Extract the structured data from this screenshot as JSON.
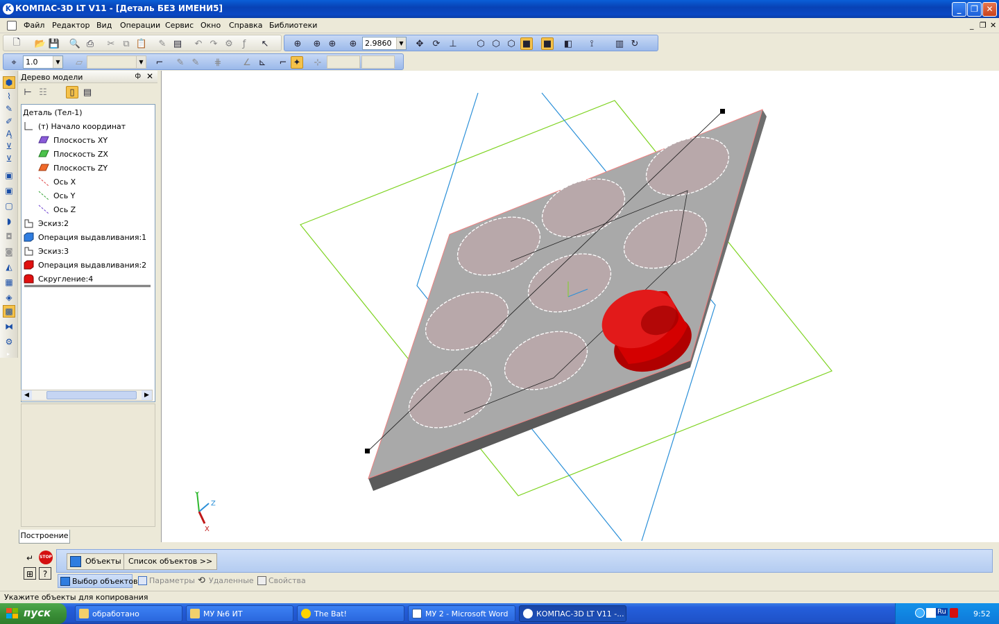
{
  "window": {
    "title": "КОМПАС-3D LT V11 - [Деталь БЕЗ ИМЕНИ5]",
    "icon_letter": "K",
    "minimize_label": "_",
    "maximize_label": "❐",
    "close_label": "✕"
  },
  "menu": {
    "items": [
      "Файл",
      "Редактор",
      "Вид",
      "Операции",
      "Сервис",
      "Окно",
      "Справка",
      "Библиотеки"
    ],
    "mdi_controls": [
      "_",
      "❐",
      "✕"
    ]
  },
  "toolbar": {
    "zoom_value": "2.9860",
    "step_value": "1.0"
  },
  "tree": {
    "panel_title": "Дерево модели",
    "pin_label": "ф",
    "close_label": "✕",
    "items": [
      {
        "label": "Деталь (Тел-1)",
        "icon": "none"
      },
      {
        "label": "(т) Начало координат",
        "icon": "origin-icon"
      },
      {
        "label": "Плоскость XY",
        "icon": "plane-xy-icon"
      },
      {
        "label": "Плоскость ZX",
        "icon": "plane-zx-icon"
      },
      {
        "label": "Плоскость ZY",
        "icon": "plane-zy-icon"
      },
      {
        "label": "Ось X",
        "icon": "axis-x-icon"
      },
      {
        "label": "Ось Y",
        "icon": "axis-y-icon"
      },
      {
        "label": "Ось Z",
        "icon": "axis-z-icon"
      },
      {
        "label": "Эскиз:2",
        "icon": "sketch-icon"
      },
      {
        "label": "Операция выдавливания:1",
        "icon": "extrude-icon"
      },
      {
        "label": "Эскиз:3",
        "icon": "sketch-icon"
      },
      {
        "label": "Операция выдавливания:2",
        "icon": "extrude-red-icon"
      },
      {
        "label": "Скругление:4",
        "icon": "fillet-icon"
      }
    ],
    "tab_label": "Построение"
  },
  "triad": {
    "x": "X",
    "y": "Y",
    "z": "Z"
  },
  "propbar": {
    "objects_label": "Объекты",
    "list_label": "Список объектов  >>",
    "tabs": [
      "Выбор объектов",
      "Параметры",
      "Удаленные",
      "Свойства"
    ],
    "stop_label": "STOP",
    "help_label": "?"
  },
  "status": {
    "message": "Укажите объекты для копирования"
  },
  "taskbar": {
    "start_label": "пуск",
    "tasks": [
      {
        "label": "обработано",
        "icon": "folder-icon"
      },
      {
        "label": "МУ №6 ИТ",
        "icon": "folder-icon"
      },
      {
        "label": "The Bat!",
        "icon": "bat-icon"
      },
      {
        "label": "МУ 2 - Microsoft Word",
        "icon": "word-icon"
      },
      {
        "label": "КОМПАС-3D LT V11 -...",
        "icon": "kompas-icon"
      }
    ],
    "lang": "RU",
    "tray_lang": "Ru",
    "clock": "9:52"
  },
  "colors": {
    "accent_blue": "#0a4ac0",
    "extrude_red": "#d40000",
    "plane_green": "#7ed321",
    "plane_blue": "#2a8fd8",
    "plate_gray": "#a9a9a9"
  }
}
